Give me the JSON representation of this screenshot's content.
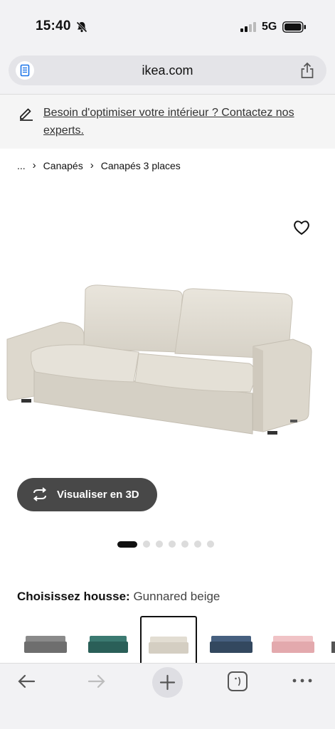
{
  "status_bar": {
    "time": "15:40",
    "network": "5G"
  },
  "browser": {
    "url": "ikea.com"
  },
  "banner": {
    "text": "Besoin d'optimiser votre intérieur ? Contactez nos experts."
  },
  "breadcrumb": {
    "items": [
      "...",
      "Canapés",
      "Canapés 3 places"
    ]
  },
  "product": {
    "view_3d_label": "Visualiser en 3D",
    "gallery": {
      "image_count": 7,
      "active_index": 0
    }
  },
  "cover": {
    "label": "Choisissez housse:",
    "selected": "Gunnared beige",
    "swatch_colors": [
      "#7a7a7a",
      "#2f6b63",
      "#d9d4c8",
      "#37506e",
      "#e8b4b8"
    ]
  },
  "colors": {
    "banner_bg": "#f5f5f5",
    "chrome_bg": "#f2f2f4",
    "button_dark": "#484848"
  }
}
